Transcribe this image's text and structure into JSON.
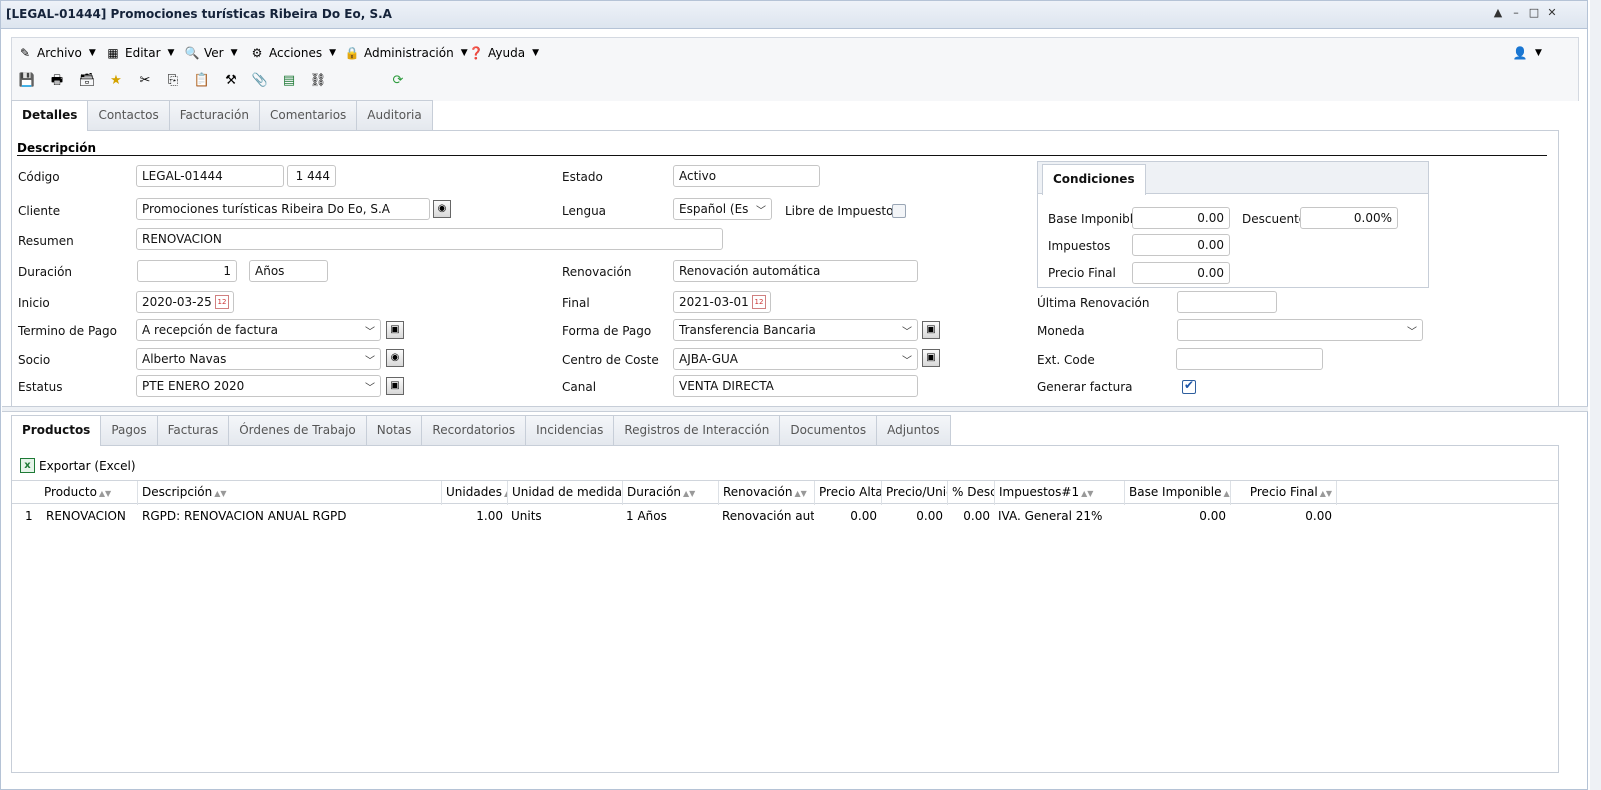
{
  "window": {
    "title": "[LEGAL-01444] Promociones turísticas Ribeira Do Eo, S.A",
    "controls": [
      "▲",
      "–",
      "□",
      "✕"
    ]
  },
  "menu": [
    {
      "label": "Archivo",
      "icon": "archivo-icon"
    },
    {
      "label": "Editar",
      "icon": "editar-icon"
    },
    {
      "label": "Ver",
      "icon": "ver-icon"
    },
    {
      "label": "Acciones",
      "icon": "acciones-icon"
    },
    {
      "label": "Administración",
      "icon": "lock-icon"
    },
    {
      "label": "Ayuda",
      "icon": "help-icon"
    }
  ],
  "top_tabs": [
    "Detalles",
    "Contactos",
    "Facturación",
    "Comentarios",
    "Auditoria"
  ],
  "section_title": "Descripción",
  "labels": {
    "codigo": "Código",
    "cliente": "Cliente",
    "resumen": "Resumen",
    "duracion": "Duración",
    "inicio": "Inicio",
    "termino_pago": "Termino de Pago",
    "socio": "Socio",
    "estatus": "Estatus",
    "estado": "Estado",
    "lengua": "Lengua",
    "libre_impuestos": "Libre de Impuestos",
    "renovacion": "Renovación",
    "final": "Final",
    "forma_pago": "Forma de Pago",
    "centro_coste": "Centro de Coste",
    "canal": "Canal",
    "ultima_renovacion": "Última Renovación",
    "moneda": "Moneda",
    "ext_code": "Ext. Code",
    "generar_factura": "Generar factura"
  },
  "fields": {
    "codigo": "LEGAL-01444",
    "codigo_num": "1 444",
    "cliente": "Promociones turísticas Ribeira Do Eo, S.A",
    "resumen": "RENOVACION",
    "duracion": "1",
    "duracion_unidad": "Años",
    "inicio": "2020-03-25",
    "termino_pago": "A recepción de factura",
    "socio": "Alberto Navas",
    "estatus": "PTE ENERO 2020",
    "estado": "Activo",
    "lengua": "Español (Es",
    "renovacion": "Renovación automática",
    "final": "2021-03-01",
    "forma_pago": "Transferencia Bancaria",
    "centro_coste": "AJBA-GUA",
    "canal": "VENTA DIRECTA",
    "ultima_renovacion": "",
    "moneda": "",
    "ext_code": "",
    "libre_impuestos": false,
    "generar_factura": true
  },
  "condiciones": {
    "tab": "Condiciones",
    "base_imponible_label": "Base Imponible",
    "base_imponible": "0.00",
    "descuento_label": "Descuento",
    "descuento": "0.00%",
    "impuestos_label": "Impuestos",
    "impuestos": "0.00",
    "precio_final_label": "Precio Final",
    "precio_final": "0.00"
  },
  "bottom_tabs": [
    "Productos",
    "Pagos",
    "Facturas",
    "Órdenes de Trabajo",
    "Notas",
    "Recordatorios",
    "Incidencias",
    "Registros de Interacción",
    "Documentos",
    "Adjuntos"
  ],
  "export_label": "Exportar (Excel)",
  "grid": {
    "columns": [
      "Producto",
      "Descripción",
      "Unidades",
      "Unidad de medida",
      "Duración",
      "Renovación",
      "Precio Alta",
      "Precio/Unidad",
      "% Descuento",
      "Impuestos#1",
      "Base Imponible",
      "Precio Final"
    ],
    "rows": [
      {
        "n": "1",
        "producto": "RENOVACION",
        "descripcion": "RGPD: RENOVACION ANUAL RGPD",
        "unidades": "1.00",
        "unidad_medida": "Units",
        "duracion": "1 Años",
        "renovacion": "Renovación automática",
        "precio_alta": "0.00",
        "precio_unidad": "0.00",
        "descuento": "0.00",
        "impuestos": "IVA. General 21%",
        "base_imponible": "0.00",
        "precio_final": "0.00"
      }
    ]
  },
  "colors": {
    "accent": "#1d56a8",
    "border": "#c7ced8",
    "titlebar": "#dde5ef"
  }
}
